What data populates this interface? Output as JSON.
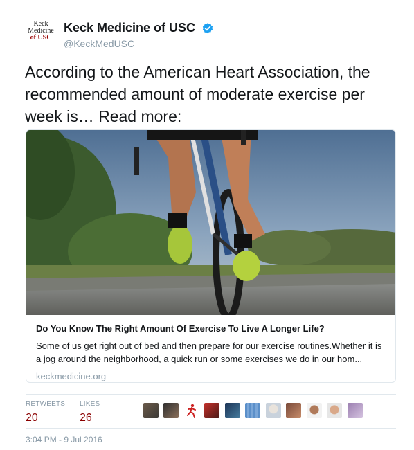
{
  "account": {
    "logo_lines": [
      "Keck",
      "Medicine",
      "of USC"
    ],
    "display_name": "Keck Medicine of USC",
    "handle": "@KeckMedUSC",
    "verified_color": "#1da1f2"
  },
  "tweet": {
    "text": "According to the American Heart Association, the recommended amount of moderate exercise per week is… Read more:"
  },
  "card": {
    "image_alt": "cyclist-riding-road",
    "title": "Do You Know The Right Amount Of Exercise To Live A Longer Life?",
    "description": "Some of us get right out of bed and then prepare for our exercise routines.Whether it is a jog around the neighborhood, a quick run or some exercises we do in our hom...",
    "domain": "keckmedicine.org"
  },
  "stats": {
    "retweets_label": "RETWEETS",
    "retweets_value": "20",
    "likes_label": "LIKES",
    "likes_value": "26",
    "accent_color": "#8b0000"
  },
  "timestamp": "3:04 PM - 9 Jul 2016"
}
